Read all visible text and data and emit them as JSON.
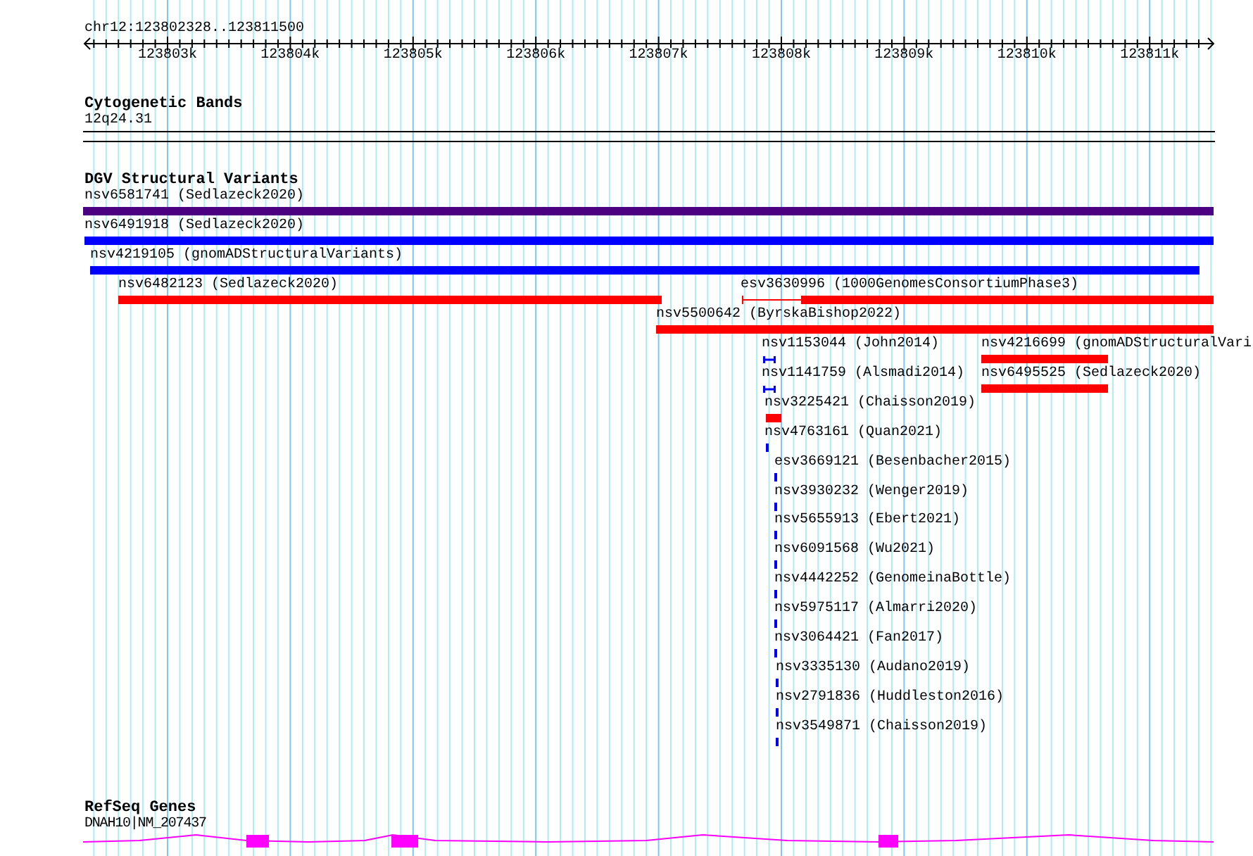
{
  "location": "chr12:123802328..123811500",
  "ruler": {
    "ticks": [
      "123803k",
      "123804k",
      "123805k",
      "123806k",
      "123807k",
      "123808k",
      "123809k",
      "123810k",
      "123811k"
    ]
  },
  "tracks": [
    {
      "kind": "bands",
      "title": "Cytogenetic Bands",
      "items": [
        {
          "label": "12q24.31"
        }
      ]
    },
    {
      "kind": "variants",
      "title": "DGV Structural Variants",
      "items": [
        {
          "label": "nsv6581741 (Sedlazeck2020)",
          "color": "#4b0082",
          "kind": "bar"
        },
        {
          "label": "nsv6491918 (Sedlazeck2020)",
          "color": "#0000ff",
          "kind": "bar"
        },
        {
          "label": "nsv4219105 (gnomADStructuralVariants)",
          "color": "#0000ff",
          "kind": "bar"
        },
        {
          "label": "nsv6482123 (Sedlazeck2020)",
          "color": "#ff0000",
          "kind": "bar"
        },
        {
          "label": "esv3630996 (1000GenomesConsortiumPhase3)",
          "color": "#ff0000",
          "kind": "split"
        },
        {
          "label": "nsv5500642 (ByrskaBishop2022)",
          "color": "#ff0000",
          "kind": "bar"
        },
        {
          "label": "nsv1153044 (John2014)",
          "color": "#0000ff",
          "kind": "ibeam"
        },
        {
          "label": "nsv4216699 (gnomADStructuralVari",
          "color": "#ff0000",
          "kind": "bar"
        },
        {
          "label": "nsv1141759 (Alsmadi2014)",
          "color": "#0000ff",
          "kind": "ibeam"
        },
        {
          "label": "nsv6495525 (Sedlazeck2020)",
          "color": "#ff0000",
          "kind": "bar"
        },
        {
          "label": "nsv3225421 (Chaisson2019)",
          "color": "#ff0000",
          "kind": "bar"
        },
        {
          "label": "nsv4763161 (Quan2021)",
          "color": "#0000ff",
          "kind": "bar"
        },
        {
          "label": "esv3669121 (Besenbacher2015)",
          "color": "#0000ff",
          "kind": "bar"
        },
        {
          "label": "nsv3930232 (Wenger2019)",
          "color": "#0000ff",
          "kind": "bar"
        },
        {
          "label": "nsv5655913 (Ebert2021)",
          "color": "#0000ff",
          "kind": "bar"
        },
        {
          "label": "nsv6091568 (Wu2021)",
          "color": "#0000ff",
          "kind": "bar"
        },
        {
          "label": "nsv4442252 (GenomeinaBottle)",
          "color": "#0000ff",
          "kind": "bar"
        },
        {
          "label": "nsv5975117 (Almarri2020)",
          "color": "#0000ff",
          "kind": "bar"
        },
        {
          "label": "nsv3064421 (Fan2017)",
          "color": "#0000ff",
          "kind": "bar"
        },
        {
          "label": "nsv3335130 (Audano2019)",
          "color": "#0000ff",
          "kind": "bar"
        },
        {
          "label": "nsv2791836 (Huddleston2016)",
          "color": "#0000ff",
          "kind": "bar"
        },
        {
          "label": "nsv3549871 (Chaisson2019)",
          "color": "#0000ff",
          "kind": "bar"
        }
      ]
    },
    {
      "kind": "genes",
      "title": "RefSeq Genes",
      "items": [
        {
          "label": "DNAH10|NM_207437",
          "color": "#ff00ff"
        }
      ]
    }
  ]
}
